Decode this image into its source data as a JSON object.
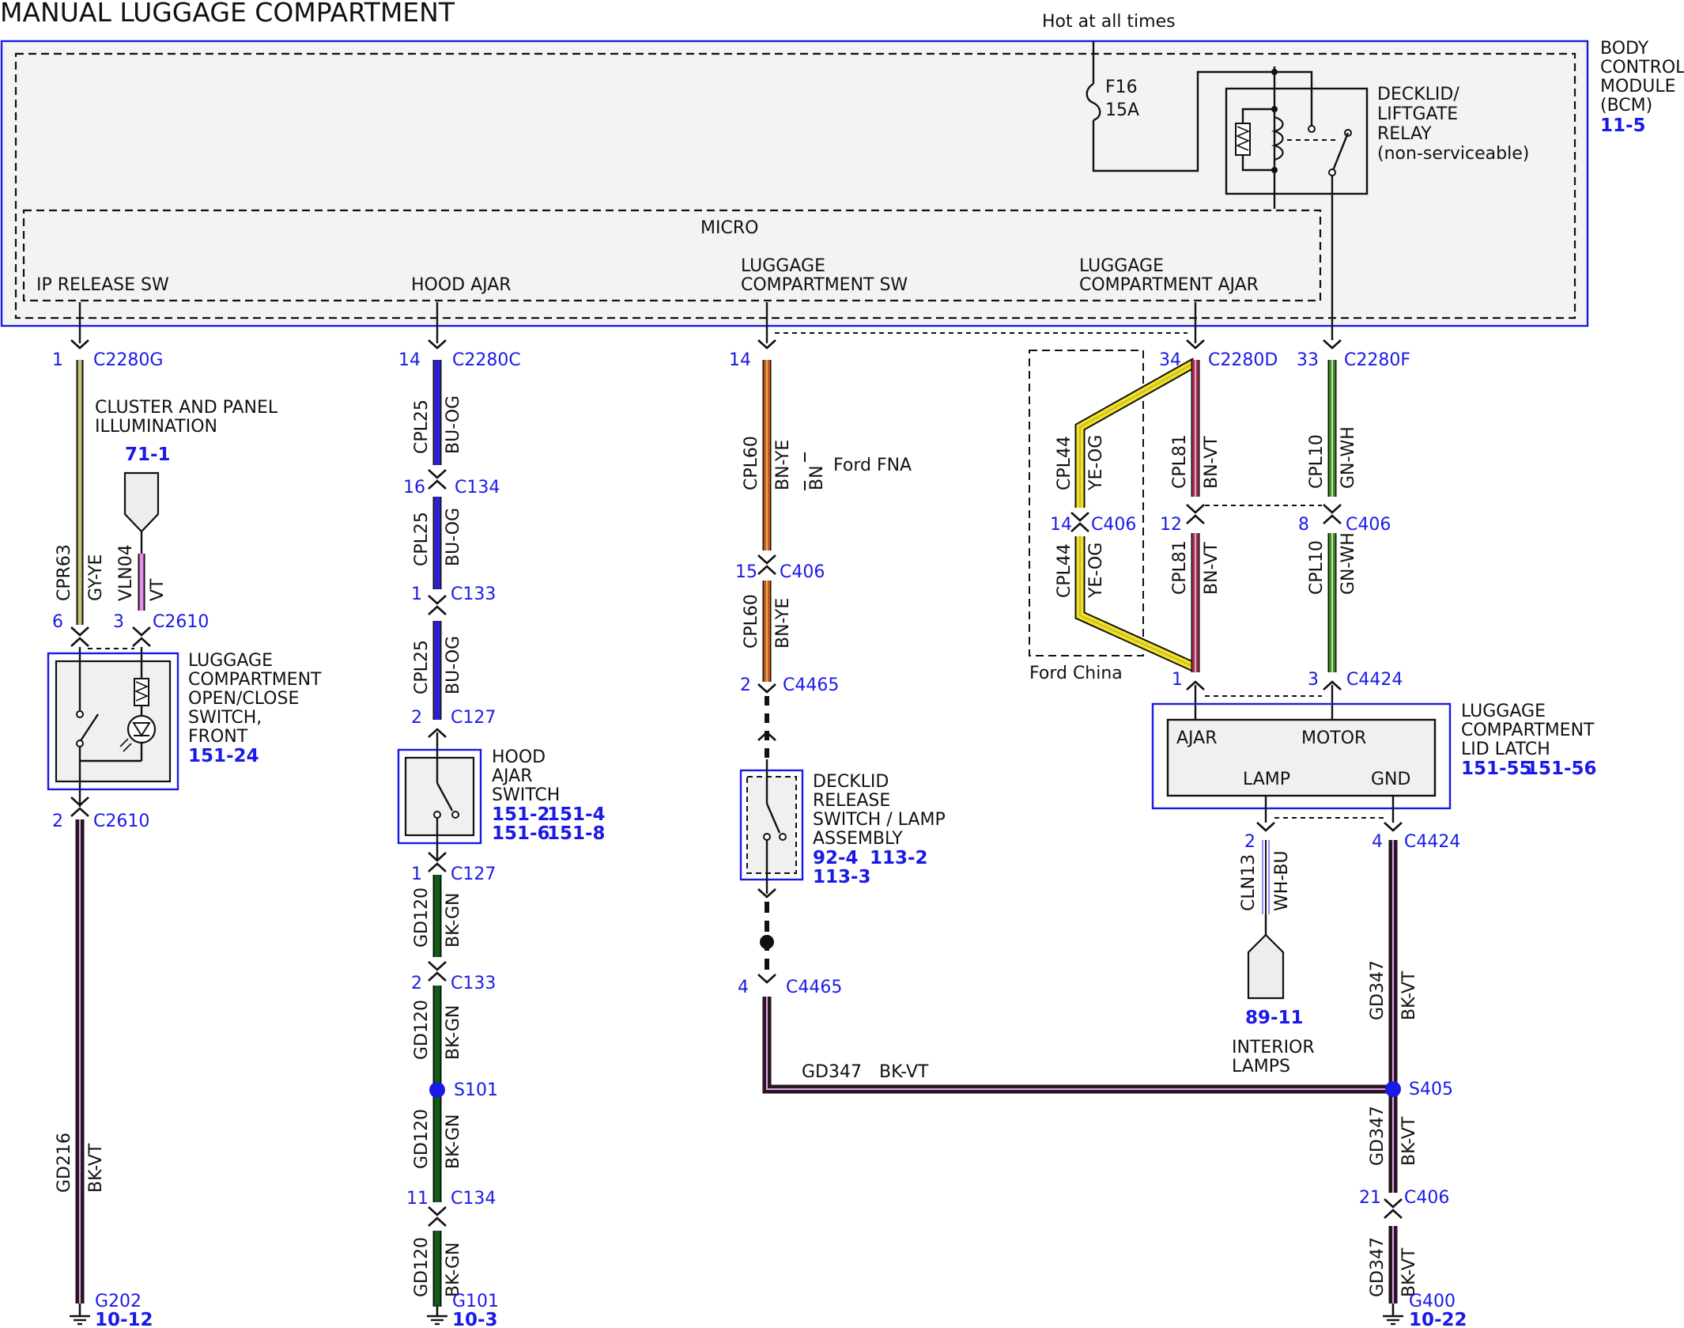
{
  "title": "MANUAL LUGGAGE COMPARTMENT",
  "colors": {
    "connector_blue": "#1a1ae6",
    "gy_ye": "#c8c27a",
    "vt": "#e58be8",
    "bu_og": "#2a21c8",
    "bk_gn": "#0d5f14",
    "bn_ye": "#c8581c",
    "ye_og": "#f2e21b",
    "bn_vt": "#a3304f",
    "gn_wh": "#3c8a22",
    "bk_vt": "#2b1628",
    "wh_bu": "#8a8cff"
  },
  "bcm": {
    "name_lines": [
      "BODY",
      "CONTROL",
      "MODULE",
      "(BCM)"
    ],
    "ref": "11-5",
    "hot_label": "Hot at all times",
    "fuse_name": "F16",
    "fuse_rating": "15A",
    "relay_lines": [
      "DECKLID/",
      "LIFTGATE",
      "RELAY",
      "(non-serviceable)"
    ],
    "micro_label": "MICRO",
    "inputs": {
      "ip_release": "IP RELEASE SW",
      "hood_ajar": "HOOD AJAR",
      "lugg_sw_1": "LUGGAGE",
      "lugg_sw_2": "COMPARTMENT SW",
      "lugg_ajar_1": "LUGGAGE",
      "lugg_ajar_2": "COMPARTMENT AJAR"
    }
  },
  "col1": {
    "conn_top_pin": "1",
    "conn_top": "C2280G",
    "illum_1": "CLUSTER AND PANEL",
    "illum_2": "ILLUMINATION",
    "illum_ref": "71-1",
    "w1_circuit": "CPR63",
    "w1_color": "GY-YE",
    "w2_circuit": "VLN04",
    "w2_color": "VT",
    "pin6": "6",
    "pin3": "3",
    "conn_2610": "C2610",
    "switch_lines": [
      "LUGGAGE",
      "COMPARTMENT",
      "OPEN/CLOSE",
      "SWITCH,",
      "FRONT"
    ],
    "switch_ref": "151-24",
    "pin2": "2",
    "conn_2610b": "C2610",
    "w3_circuit": "GD216",
    "w3_color": "BK-VT",
    "ground": "G202",
    "ground_ref": "10-12"
  },
  "col2": {
    "pin14": "14",
    "c2280c": "C2280C",
    "w_circuit": "CPL25",
    "w_color": "BU-OG",
    "pin16": "16",
    "c134": "C134",
    "pin1a": "1",
    "c133": "C133",
    "pin2a": "2",
    "c127": "C127",
    "switch_lines": [
      "HOOD",
      "AJAR",
      "SWITCH"
    ],
    "switch_refs": [
      "151-2",
      "151-4",
      "151-6",
      "151-8"
    ],
    "pin1b": "1",
    "c127b": "C127",
    "g_circuit": "GD120",
    "g_color": "BK-GN",
    "pin2b": "2",
    "c133b": "C133",
    "splice": "S101",
    "pin11": "11",
    "c134b": "C134",
    "ground": "G101",
    "ground_ref": "10-3"
  },
  "col3": {
    "pin14": "14",
    "w_circuit": "CPL60",
    "w_color": "BN-YE",
    "alt_color": "BN",
    "ford_fna": "Ford FNA",
    "pin15": "15",
    "c406": "C406",
    "pin2": "2",
    "c4465": "C4465",
    "switch_lines": [
      "DECKLID",
      "RELEASE",
      "SWITCH / LAMP",
      "ASSEMBLY"
    ],
    "switch_refs": [
      "92-4",
      "113-2",
      "113-3"
    ],
    "pin4": "4",
    "c4465b": "C4465",
    "g_circuit": "GD347",
    "g_color": "BK-VT"
  },
  "col4": {
    "pin34": "34",
    "c2280d": "C2280D",
    "y_circuit": "CPL44",
    "y_color": "YE-OG",
    "pin14": "14",
    "c406": "C406",
    "r_circuit": "CPL81",
    "r_color": "BN-VT",
    "pin12": "12",
    "ford_china": "Ford China",
    "pin1": "1"
  },
  "col5": {
    "pin33": "33",
    "c2280f": "C2280F",
    "g_circuit": "CPL10",
    "g_color": "GN-WH",
    "pin8": "8",
    "c406": "C406",
    "pin3": "3",
    "c4424": "C4424",
    "latch_lines": [
      "LUGGAGE",
      "COMPARTMENT",
      "LID LATCH"
    ],
    "latch_refs": [
      "151-55",
      "151-56"
    ],
    "latch_pins": {
      "ajar": "AJAR",
      "motor": "MOTOR",
      "lamp": "LAMP",
      "gnd": "GND"
    },
    "pin2": "2",
    "lamp_circuit": "CLN13",
    "lamp_color": "WH-BU",
    "interior_ref": "89-11",
    "interior_1": "INTERIOR",
    "interior_2": "LAMPS",
    "pin4": "4",
    "c4424b": "C4424",
    "gd_circuit": "GD347",
    "gd_color": "BK-VT",
    "splice": "S405",
    "pin21": "21",
    "c406b": "C406",
    "ground": "G400",
    "ground_ref": "10-22"
  }
}
